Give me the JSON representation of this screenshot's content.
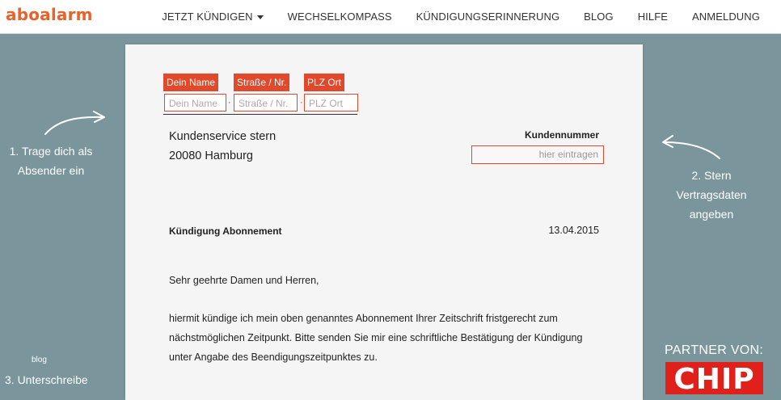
{
  "header": {
    "logo": "aboalarm",
    "nav": [
      {
        "label": "JETZT KÜNDIGEN",
        "dropdown": true
      },
      {
        "label": "WECHSELKOMPASS"
      },
      {
        "label": "KÜNDIGUNGSERINNERUNG"
      },
      {
        "label": "BLOG"
      },
      {
        "label": "HILFE"
      },
      {
        "label": "ANMELDUNG"
      }
    ]
  },
  "letter": {
    "sender_fields": [
      {
        "tag": "Dein Name",
        "placeholder": "Dein Name"
      },
      {
        "tag": "Straße / Nr.",
        "placeholder": "Straße / Nr."
      },
      {
        "tag": "PLZ Ort",
        "placeholder": "PLZ Ort"
      }
    ],
    "separator": "·",
    "recipient": [
      "Kundenservice stern",
      "20080 Hamburg"
    ],
    "kundennummer_label": "Kundennummer",
    "kundennummer_placeholder": "hier eintragen",
    "subject": "Kündigung Abonnement",
    "date": "13.04.2015",
    "greeting": "Sehr geehrte Damen und Herren,",
    "body": [
      "hiermit kündige ich mein oben genanntes Abonnement Ihrer Zeitschrift fristgerecht zum",
      "nächstmöglichen Zeitpunkt. Bitte senden Sie mir eine  schriftliche Bestätigung der Kündigung",
      "unter Angabe des Beendigungszeitpunktes zu."
    ]
  },
  "steps": {
    "step1": [
      "1.  Trage dich als",
      "Absender ein"
    ],
    "step2": [
      "2.  Stern",
      "Vertragsdaten",
      "angeben"
    ],
    "step3": "3.  Unterschreibe"
  },
  "footer": {
    "blog": "blog",
    "partner": "PARTNER VON:",
    "partner_logo": "CHIP"
  },
  "colors": {
    "accent": "#e0492b",
    "logo": "#e8632a",
    "background": "#7a959b",
    "paper": "#f5f5f5"
  }
}
